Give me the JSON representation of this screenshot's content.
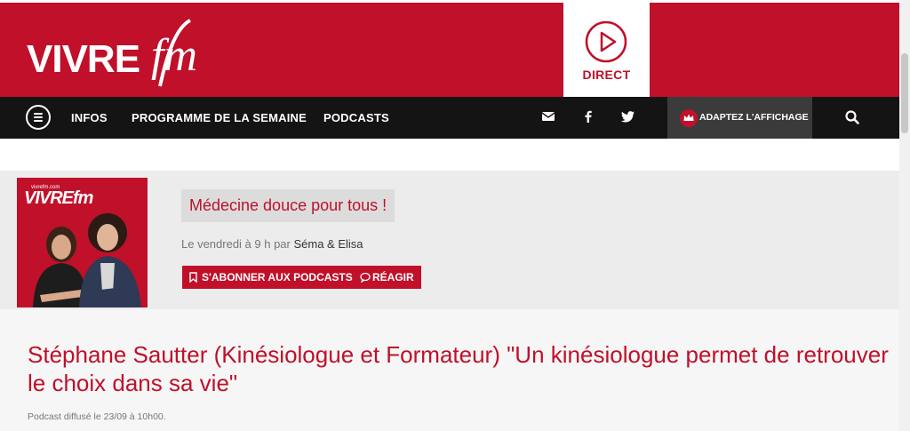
{
  "header": {
    "logo_text": "VIVREfm",
    "direct_label": "DIRECT"
  },
  "nav": {
    "items": [
      "INFOS",
      "PROGRAMME DE LA SEMAINE",
      "PODCASTS"
    ],
    "adapt_label": "ADAPTEZ L'AFFICHAGE"
  },
  "show": {
    "cover_logo_small": "vivrefm.com",
    "cover_logo": "VIVREfm",
    "title": "Médecine douce pour tous !",
    "schedule_prefix": "Le vendredi à 9 h par ",
    "hosts": "Séma & Elisa",
    "subscribe_label": "S'ABONNER AUX PODCASTS",
    "react_label": "RÉAGIR"
  },
  "article": {
    "title": "Stéphane Sautter (Kinésiologue et Formateur) \"Un kinésiologue permet de retrouver le choix dans sa vie\"",
    "meta": "Podcast diffusé le 23/09 à 10h00."
  },
  "colors": {
    "brand_red": "#c0102a",
    "nav_bg": "#141414",
    "adapt_bg": "#3b3b3b"
  },
  "icons": [
    "play-icon",
    "menu-icon",
    "mail-icon",
    "facebook-icon",
    "twitter-icon",
    "crown-icon",
    "search-icon",
    "bookmark-icon",
    "comment-icon"
  ]
}
